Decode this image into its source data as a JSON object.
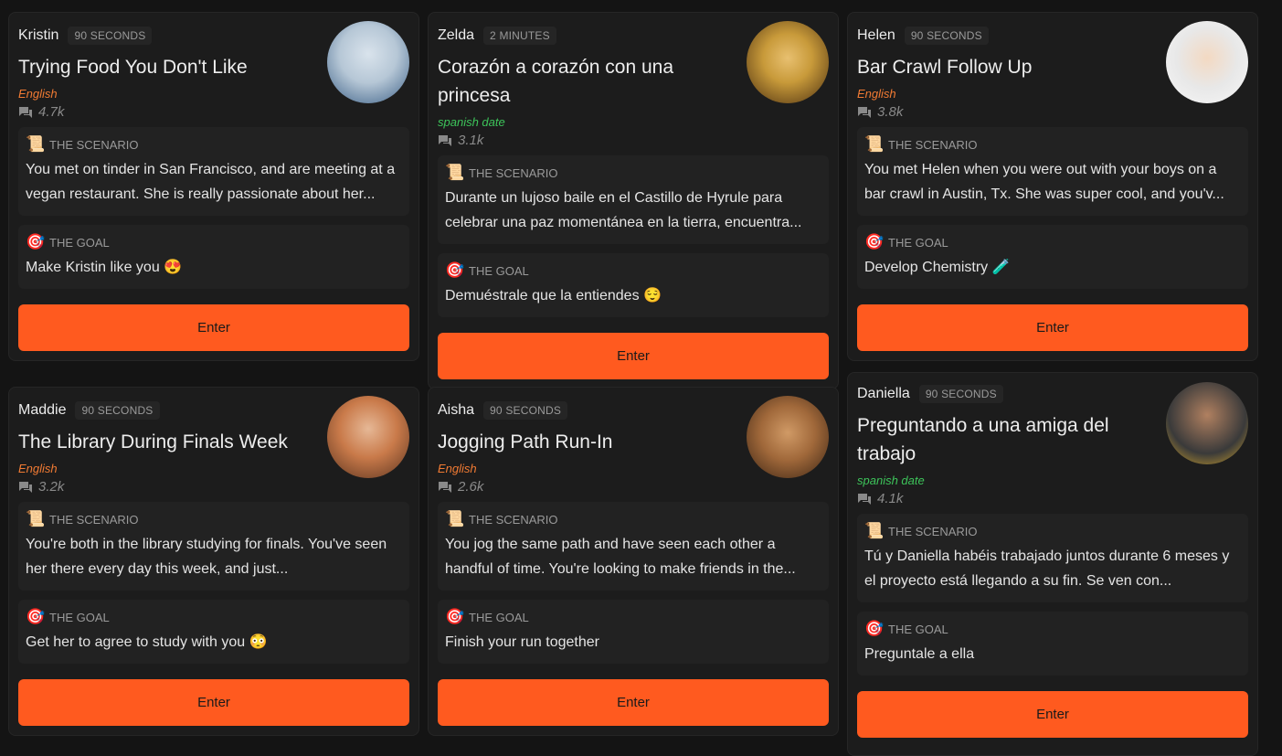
{
  "labels": {
    "scenario": "THE SCENARIO",
    "goal": "THE GOAL",
    "enter": "Enter"
  },
  "cards": [
    {
      "name": "Kristin",
      "duration": "90 SECONDS",
      "title": "Trying Food You Don't Like",
      "language": "English",
      "language_color": "#f07a33",
      "count": "4.7k",
      "scenario": "You met on tinder in San Francisco, and are meeting at a vegan restaurant. She is really passionate about her...",
      "goal": "Make Kristin like you 😍",
      "avatar_colors": [
        "#b6c7d6",
        "#3b5f86"
      ]
    },
    {
      "name": "Zelda",
      "duration": "2 MINUTES",
      "title": "Corazón a corazón con una princesa",
      "language": "spanish date",
      "language_color": "#3dc45a",
      "count": "3.1k",
      "scenario": "Durante un lujoso baile en el Castillo de Hyrule para celebrar una paz momentánea en la tierra, encuentra...",
      "goal": "Demuéstrale que la entiendes 😌",
      "avatar_colors": [
        "#c89a3a",
        "#4a2e10"
      ]
    },
    {
      "name": "Helen",
      "duration": "90 SECONDS",
      "title": "Bar Crawl Follow Up",
      "language": "English",
      "language_color": "#f07a33",
      "count": "3.8k",
      "scenario": "You met Helen when you were out with your boys on a bar crawl in Austin, Tx. She was super cool, and you'v...",
      "goal": "Develop Chemistry 🧪",
      "avatar_colors": [
        "#f2f2f2",
        "#c9a98a"
      ]
    },
    {
      "name": "Maddie",
      "duration": "90 SECONDS",
      "title": "The Library During Finals Week",
      "language": "English",
      "language_color": "#f07a33",
      "count": "3.2k",
      "scenario": "You're both in the library studying for finals. You've seen her there every day this week, and just...",
      "goal": "Get her to agree to study with you 😳",
      "avatar_colors": [
        "#c97a4a",
        "#5a3420"
      ]
    },
    {
      "name": "Aisha",
      "duration": "90 SECONDS",
      "title": "Jogging Path Run-In",
      "language": "English",
      "language_color": "#f07a33",
      "count": "2.6k",
      "scenario": "You jog the same path and have seen each other a handful of time. You're looking to make friends in the...",
      "goal": "Finish your run together",
      "avatar_colors": [
        "#a0683a",
        "#3a2414"
      ]
    },
    {
      "name": "Daniella",
      "duration": "90 SECONDS",
      "title": "Preguntando a una amiga del trabajo",
      "language": "spanish date",
      "language_color": "#3dc45a",
      "count": "4.1k",
      "scenario": "Tú y Daniella habéis trabajado juntos durante 6 meses y el proyecto está llegando a su fin. Se ven con...",
      "goal": "Preguntale a ella",
      "avatar_colors": [
        "#3a3a3a",
        "#d4a52a"
      ]
    }
  ]
}
